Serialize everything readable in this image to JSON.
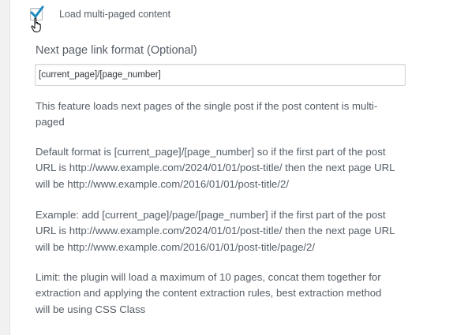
{
  "multipage": {
    "checkbox_label": "Load multi-paged content",
    "checked": true
  },
  "next_page_format": {
    "label": "Next page link format (Optional)",
    "value": "[current_page]/[page_number]"
  },
  "description": {
    "p1": "This feature loads next pages of the single post if the post content is multi-paged",
    "p2": "Default format is [current_page]/[page_number] so if the first part of the post URL is http://www.example.com/2024/01/01/post-title/ then the next page URL will be http://www.example.com/2016/01/01/post-title/2/",
    "p3": "Example: add [current_page]/page/[page_number] if the first part of the post URL is http://www.example.com/2024/01/01/post-title/ then the next page URL will be http://www.example.com/2016/01/01/post-title/page/2/",
    "p4": "Limit: the plugin will load a maximum of 10 pages, concat them together for extraction and applying the content extraction rules, best extraction method will be using CSS Class"
  }
}
